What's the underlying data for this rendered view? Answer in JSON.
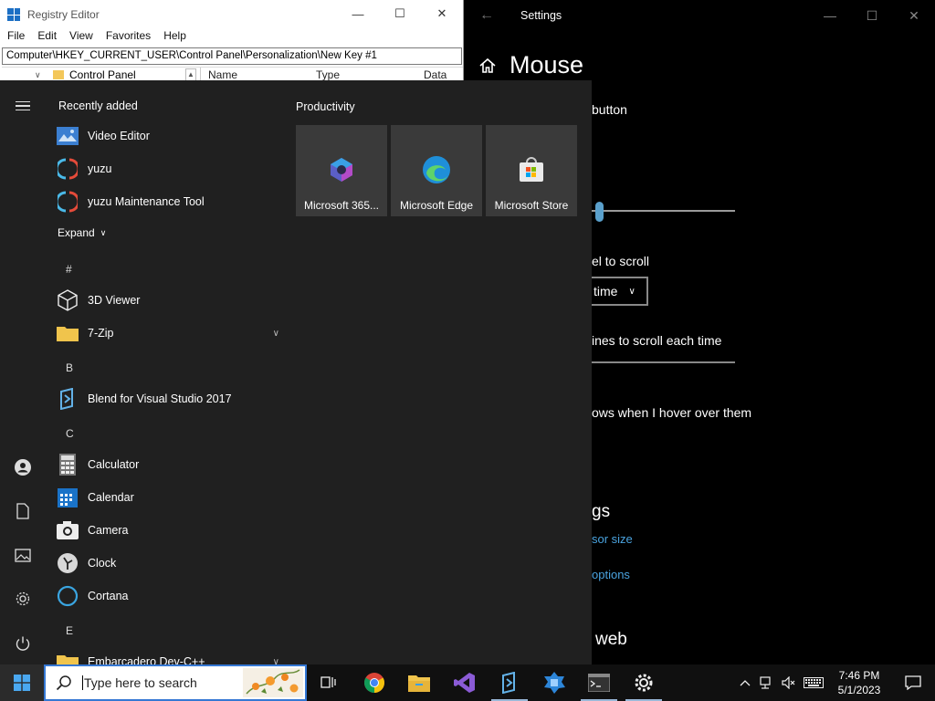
{
  "regedit": {
    "title": "Registry Editor",
    "menu": [
      "File",
      "Edit",
      "View",
      "Favorites",
      "Help"
    ],
    "address": "Computer\\HKEY_CURRENT_USER\\Control Panel\\Personalization\\New Key #1",
    "tree_item": "Control Panel",
    "columns": [
      "Name",
      "Type",
      "Data"
    ]
  },
  "settings": {
    "title": "Settings",
    "page_title": "Mouse",
    "fragments": {
      "button": "button",
      "scroll_label": "el to scroll",
      "dropdown_value": "time",
      "lines_label": "ines to scroll each time",
      "hover_label": "ows when I hover over them",
      "heading_gs": "gs",
      "link_cursor": "sor size",
      "link_options": "options",
      "heading_web": "web"
    }
  },
  "start": {
    "recently_added_label": "Recently added",
    "recent": [
      {
        "name": "Video Editor",
        "icon": "video-editor-icon"
      },
      {
        "name": "yuzu",
        "icon": "yuzu-icon"
      },
      {
        "name": "yuzu Maintenance Tool",
        "icon": "yuzu-icon"
      }
    ],
    "expand_label": "Expand",
    "letters": {
      "hash": "#",
      "b": "B",
      "c": "C",
      "e": "E"
    },
    "apps": [
      {
        "name": "3D Viewer",
        "icon": "3d-viewer-icon"
      },
      {
        "name": "7-Zip",
        "icon": "folder-icon"
      },
      {
        "name": "Blend for Visual Studio 2017",
        "icon": "blend-icon"
      },
      {
        "name": "Calculator",
        "icon": "calculator-icon"
      },
      {
        "name": "Calendar",
        "icon": "calendar-icon"
      },
      {
        "name": "Camera",
        "icon": "camera-icon"
      },
      {
        "name": "Clock",
        "icon": "clock-icon"
      },
      {
        "name": "Cortana",
        "icon": "cortana-icon"
      },
      {
        "name": "Embarcadero Dev-C++",
        "icon": "folder-icon"
      }
    ],
    "tiles_group": "Productivity",
    "tiles": [
      {
        "label": "Microsoft 365...",
        "icon": "microsoft-365-icon"
      },
      {
        "label": "Microsoft Edge",
        "icon": "edge-icon"
      },
      {
        "label": "Microsoft Store",
        "icon": "store-icon"
      }
    ]
  },
  "taskbar": {
    "search_placeholder": "Type here to search",
    "pinned": [
      "task-view-icon",
      "chrome-icon",
      "file-explorer-icon",
      "visual-studio-icon",
      "blend-icon",
      "dev-tool-icon",
      "terminal-icon",
      "settings-gear-icon"
    ],
    "time": "7:46 PM",
    "date": "5/1/2023"
  },
  "colors": {
    "start_bg": "#202020",
    "tile_bg": "#3a3a3a",
    "accent": "#3578d4",
    "link": "#4aa3df"
  }
}
